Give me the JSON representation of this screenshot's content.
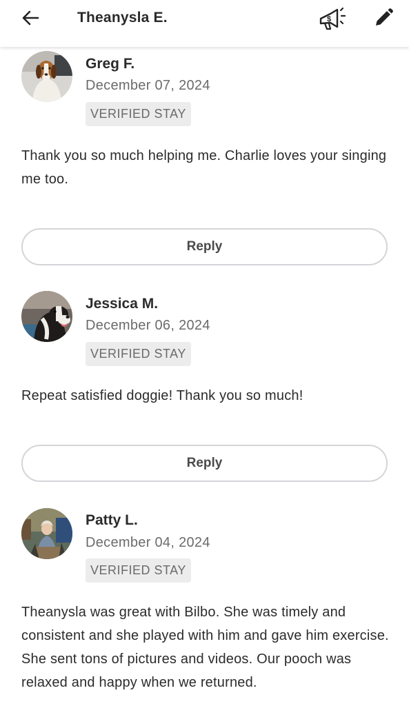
{
  "header": {
    "title": "Theanysla E.",
    "back_icon": "arrow-left-icon",
    "promo_icon": "megaphone-dollar-icon",
    "edit_icon": "pencil-icon"
  },
  "reviews": [
    {
      "name": "Greg F.",
      "date": "December 07, 2024",
      "badge": "VERIFIED STAY",
      "text": "Thank you so much helping me. Charlie loves your singing me too.",
      "reply_label": "Reply"
    },
    {
      "name": "Jessica M.",
      "date": "December 06, 2024",
      "badge": "VERIFIED STAY",
      "text": "Repeat satisfied doggie! Thank you so much!",
      "reply_label": "Reply"
    },
    {
      "name": "Patty L.",
      "date": "December 04, 2024",
      "badge": "VERIFIED STAY",
      "text": "Theanysla was great with Bilbo. She was timely and consistent and she played with him and gave him exercise. She sent tons of pictures and videos. Our pooch was relaxed and happy when we returned."
    }
  ]
}
